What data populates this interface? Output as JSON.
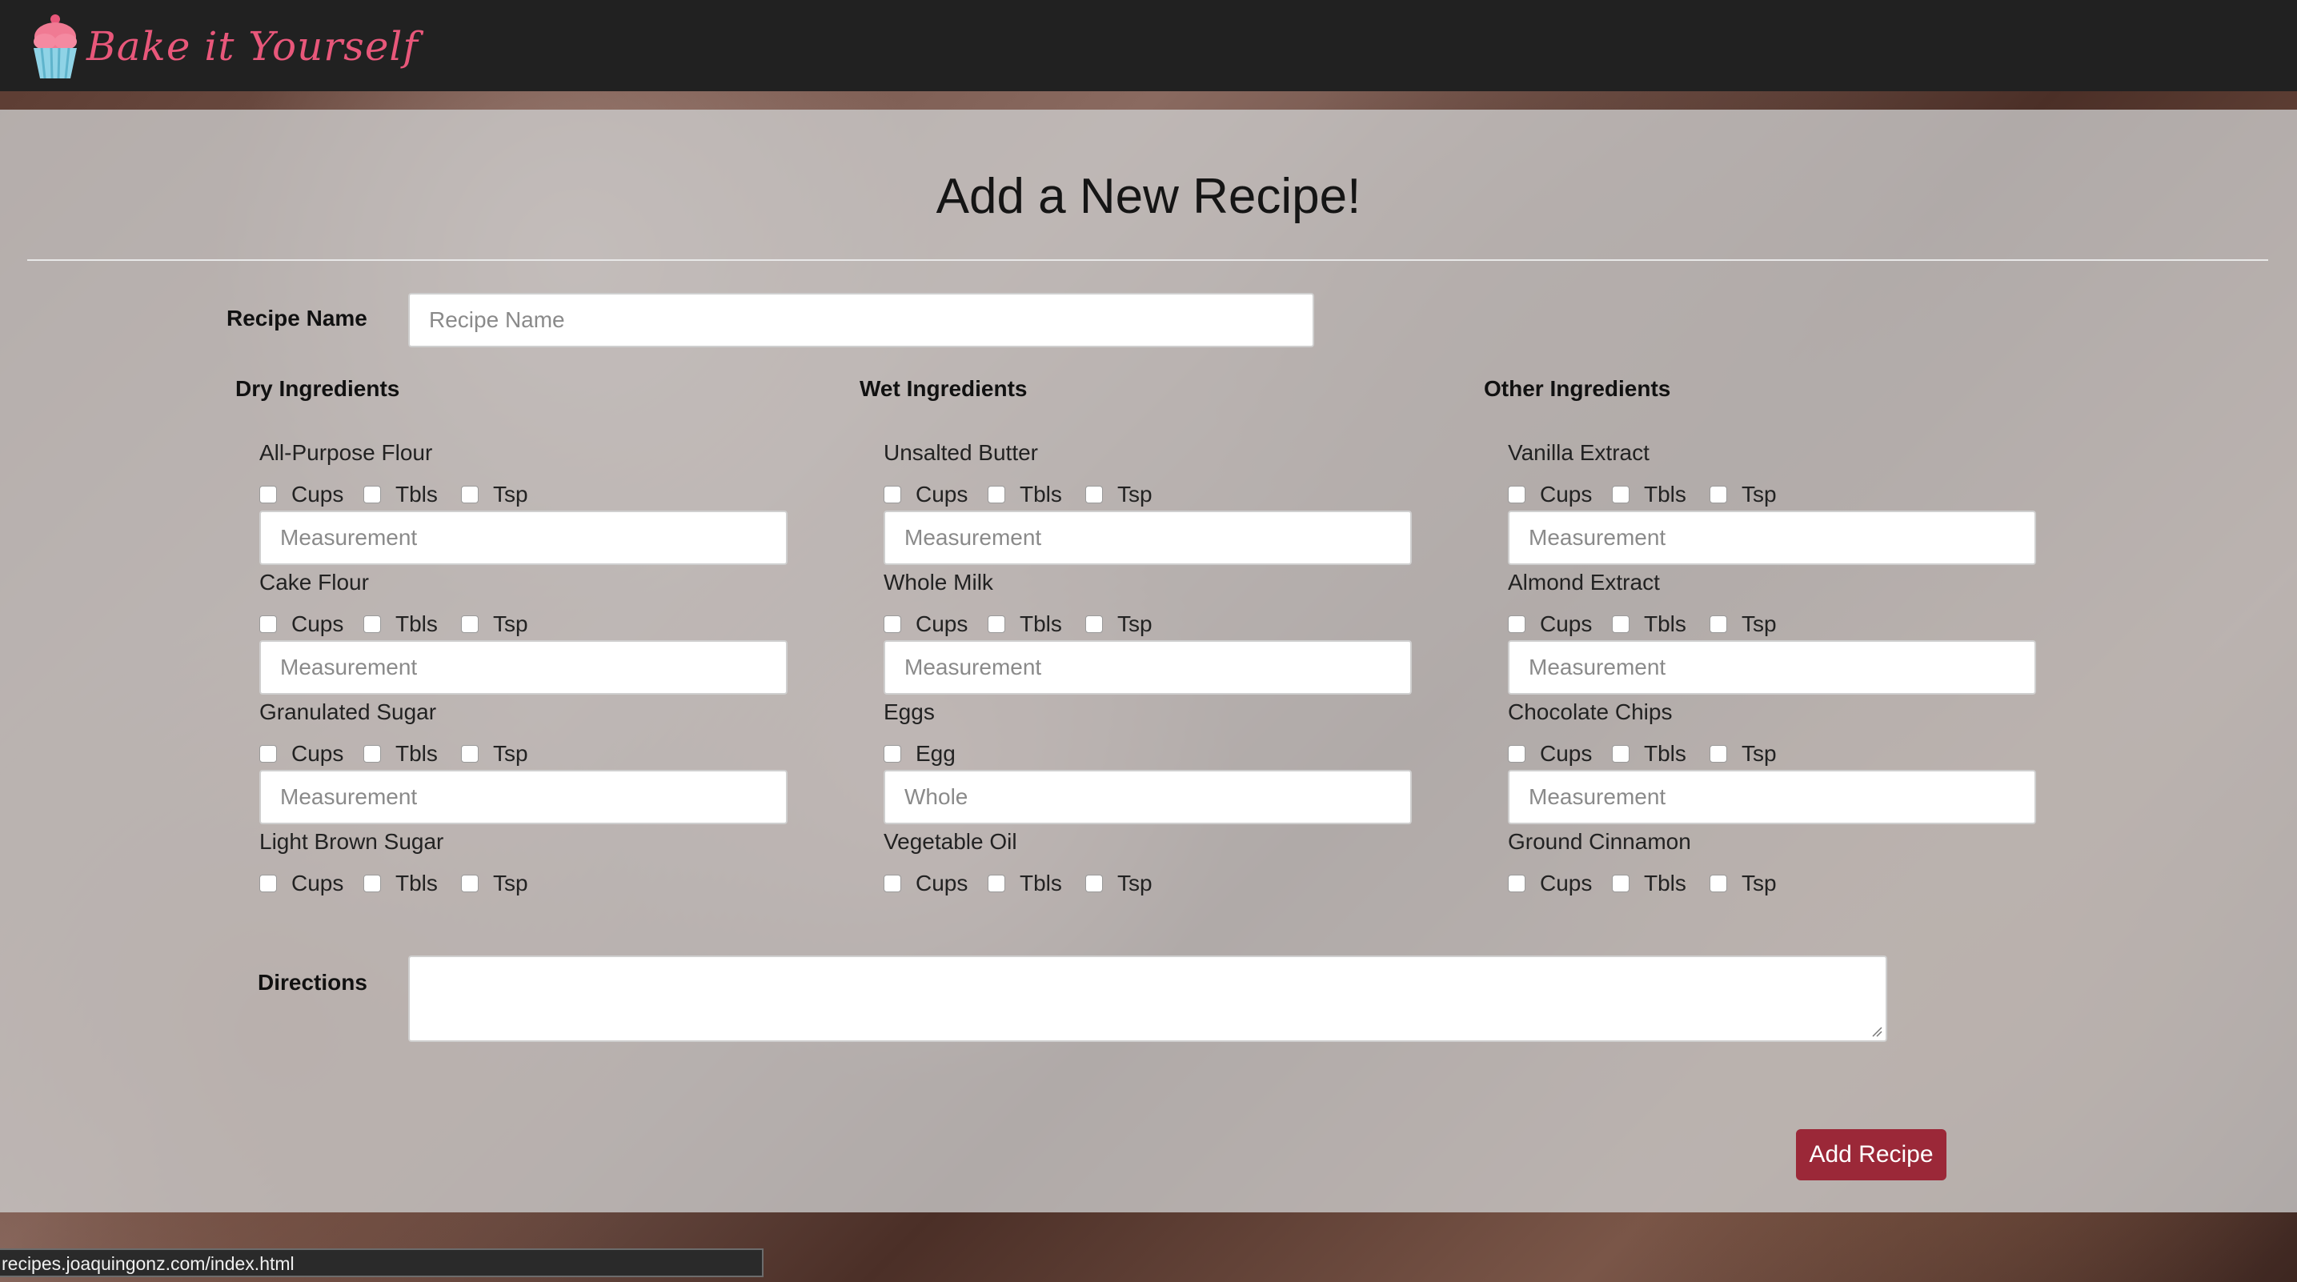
{
  "brand": {
    "name": "Bake it Yourself",
    "color": "#e8577a",
    "icon": "cupcake-icon"
  },
  "page": {
    "title": "Add a New Recipe!"
  },
  "recipe_name": {
    "label": "Recipe Name",
    "placeholder": "Recipe Name"
  },
  "columns": [
    {
      "heading": "Dry Ingredients",
      "items": [
        {
          "name": "All-Purpose Flour",
          "units": [
            "Cups",
            "Tbls",
            "Tsp"
          ],
          "placeholder": "Measurement"
        },
        {
          "name": "Cake Flour",
          "units": [
            "Cups",
            "Tbls",
            "Tsp"
          ],
          "placeholder": "Measurement"
        },
        {
          "name": "Granulated Sugar",
          "units": [
            "Cups",
            "Tbls",
            "Tsp"
          ],
          "placeholder": "Measurement"
        },
        {
          "name": "Light Brown Sugar",
          "units": [
            "Cups",
            "Tbls",
            "Tsp"
          ]
        }
      ]
    },
    {
      "heading": "Wet Ingredients",
      "items": [
        {
          "name": "Unsalted Butter",
          "units": [
            "Cups",
            "Tbls",
            "Tsp"
          ],
          "placeholder": "Measurement"
        },
        {
          "name": "Whole Milk",
          "units": [
            "Cups",
            "Tbls",
            "Tsp"
          ],
          "placeholder": "Measurement"
        },
        {
          "name": "Eggs",
          "units": [
            "Egg"
          ],
          "placeholder": "Whole"
        },
        {
          "name": "Vegetable Oil",
          "units": [
            "Cups",
            "Tbls",
            "Tsp"
          ]
        }
      ]
    },
    {
      "heading": "Other Ingredients",
      "items": [
        {
          "name": "Vanilla Extract",
          "units": [
            "Cups",
            "Tbls",
            "Tsp"
          ],
          "placeholder": "Measurement"
        },
        {
          "name": "Almond Extract",
          "units": [
            "Cups",
            "Tbls",
            "Tsp"
          ],
          "placeholder": "Measurement"
        },
        {
          "name": "Chocolate Chips",
          "units": [
            "Cups",
            "Tbls",
            "Tsp"
          ],
          "placeholder": "Measurement"
        },
        {
          "name": "Ground Cinnamon",
          "units": [
            "Cups",
            "Tbls",
            "Tsp"
          ]
        }
      ]
    }
  ],
  "directions": {
    "label": "Directions"
  },
  "submit": {
    "label": "Add Recipe",
    "color": "#9b2838"
  },
  "status_bar": {
    "url": "recipes.joaquingonz.com/index.html"
  }
}
